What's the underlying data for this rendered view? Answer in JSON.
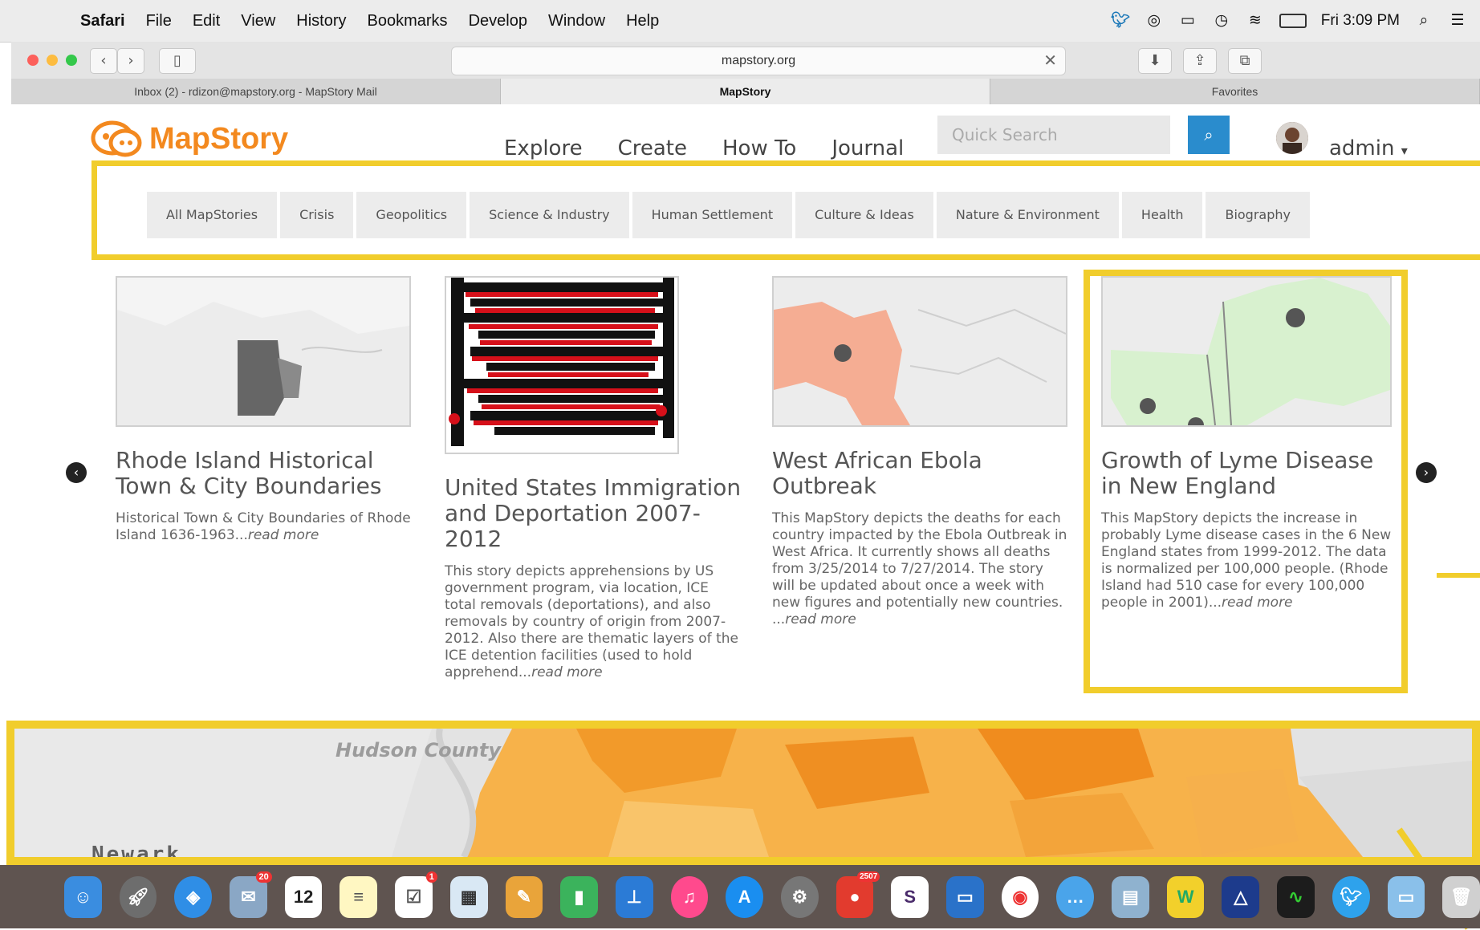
{
  "menubar": {
    "app": "Safari",
    "items": [
      "File",
      "Edit",
      "View",
      "History",
      "Bookmarks",
      "Develop",
      "Window",
      "Help"
    ],
    "clock": "Fri 3:09 PM"
  },
  "browser": {
    "url": "mapstory.org",
    "tabs": [
      {
        "title": "Inbox (2) - rdizon@mapstory.org - MapStory Mail",
        "active": false
      },
      {
        "title": "MapStory",
        "active": true
      },
      {
        "title": "Favorites",
        "active": false
      }
    ]
  },
  "site": {
    "logo_text": "MapStory",
    "nav": [
      "Explore",
      "Create",
      "How To",
      "Journal"
    ],
    "search_placeholder": "Quick Search",
    "user": "admin"
  },
  "categories": [
    "All MapStories",
    "Crisis",
    "Geopolitics",
    "Science & Industry",
    "Human Settlement",
    "Culture & Ideas",
    "Nature & Environment",
    "Health",
    "Biography"
  ],
  "cards": [
    {
      "title": "Rhode Island Historical Town & City Boundaries",
      "desc": "Historical Town & City Boundaries of Rhode Island 1636-1963...",
      "more": "read more"
    },
    {
      "title": "United States Immigration and Deportation 2007-2012",
      "desc": "This story depicts apprehensions by US government program, via location, ICE total removals (deportations), and also removals by country of origin from 2007-2012. Also there are thematic layers of the ICE detention facilities (used to hold apprehend...",
      "more": "read more"
    },
    {
      "title": "West African Ebola Outbreak",
      "desc": "This MapStory depicts the deaths for each country impacted by the Ebola Outbreak in West Africa. It currently shows all deaths from 3/25/2014 to 7/27/2014. The story will be updated about once a week with new figures and potentially new countries. ...",
      "more": "read more"
    },
    {
      "title": "Growth of Lyme Disease in New England",
      "desc": "This MapStory depicts the increase in probably Lyme disease cases in the 6 New England states from 1999-2012. The data is normalized per 100,000 people. (Rhode Island had 510 case for every 100,000 people in 2001)...",
      "more": "read more"
    }
  ],
  "map_banner": {
    "label_county": "Hudson County",
    "label_city": "Newark"
  },
  "dock": {
    "calendar_day": "12",
    "badges": [
      "20",
      "1",
      "2507"
    ]
  },
  "colors": {
    "brand_orange": "#f3891f",
    "highlight_yellow": "#f1cd2c",
    "search_blue": "#2a8ccd"
  }
}
